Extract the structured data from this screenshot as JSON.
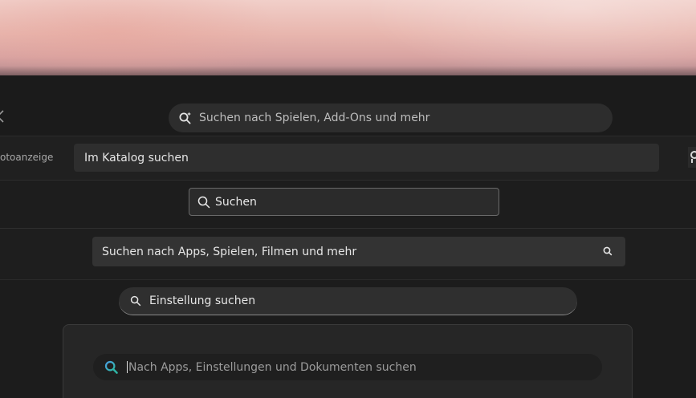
{
  "xbox_app": {
    "search_placeholder": "Suchen nach Spielen, Add-Ons und mehr"
  },
  "photos_app": {
    "sidebar_label": "otoanzeige",
    "search_text": "Im Katalog suchen"
  },
  "generic_search": {
    "text": "Suchen"
  },
  "store_app": {
    "search_placeholder": "Suchen nach Apps, Spielen, Filmen und mehr"
  },
  "settings_app": {
    "search_placeholder": "Einstellung suchen"
  },
  "start_menu": {
    "search_placeholder": "Nach Apps, Einstellungen und Dokumenten suchen"
  },
  "colors": {
    "background": "#1c1c1c",
    "field": "#2e2e2e",
    "text": "#e6e6e6",
    "placeholder": "#9c9c9c",
    "search_icon_blue": "#4a9fe0",
    "search_icon_teal": "#2fb6a6"
  },
  "icons": {
    "back": "chevron-left-icon",
    "xbox_search": "search-sparkle-icon",
    "search": "search-icon",
    "start_search": "search-color-icon"
  }
}
